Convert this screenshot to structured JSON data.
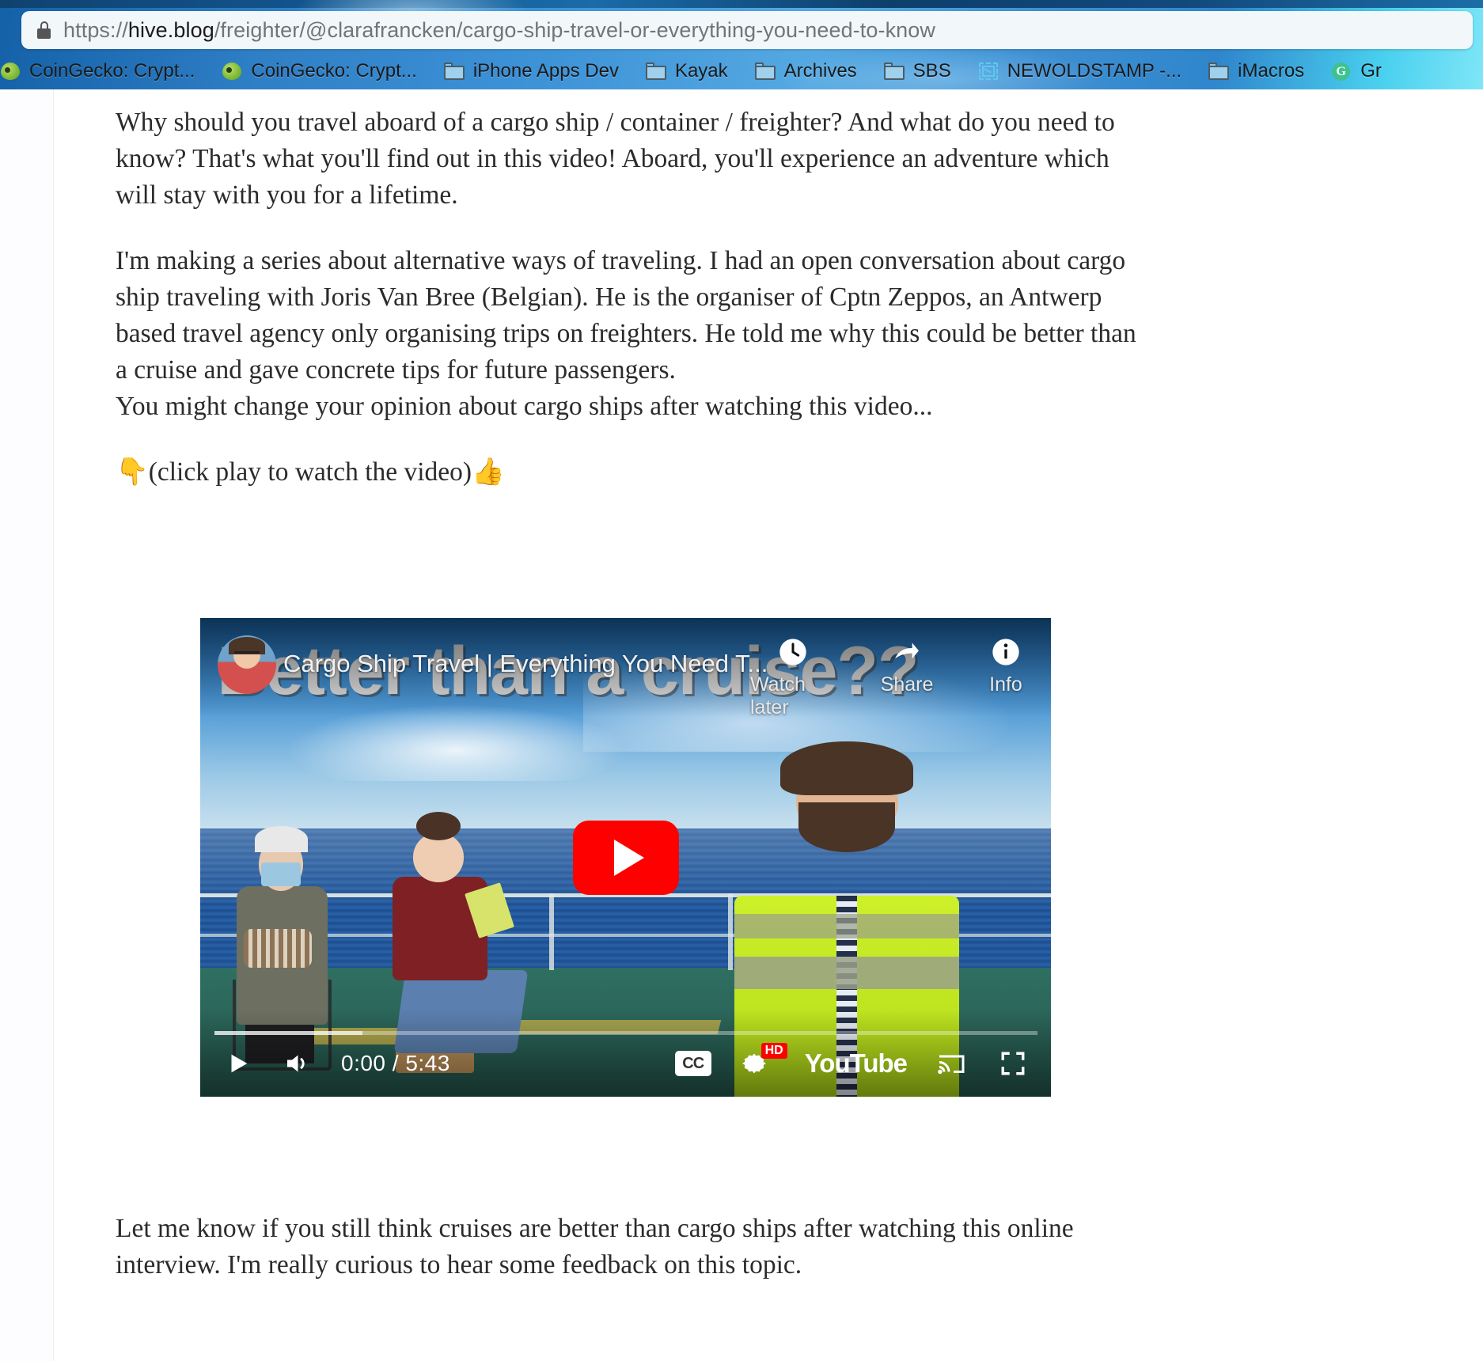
{
  "browser": {
    "address_bar": {
      "lock_icon": "lock-icon",
      "scheme": "https://",
      "host": "hive.blog",
      "path": "/freighter/@clarafrancken/cargo-ship-travel-or-everything-you-need-to-know",
      "full_url": "https://hive.blog/freighter/@clarafrancken/cargo-ship-travel-or-everything-you-need-to-know"
    },
    "bookmarks": [
      {
        "label": "CoinGecko: Crypt...",
        "icon": "gecko-icon"
      },
      {
        "label": "CoinGecko: Crypt...",
        "icon": "gecko-icon"
      },
      {
        "label": "iPhone Apps Dev",
        "icon": "folder-icon"
      },
      {
        "label": "Kayak",
        "icon": "folder-icon"
      },
      {
        "label": "Archives",
        "icon": "folder-icon"
      },
      {
        "label": "SBS",
        "icon": "folder-icon"
      },
      {
        "label": "NEWOLDSTAMP -...",
        "icon": "stamp-icon"
      },
      {
        "label": "iMacros",
        "icon": "folder-icon"
      },
      {
        "label": "Gr",
        "icon": "grammarly-icon"
      }
    ]
  },
  "article": {
    "paragraph_1": "Why should you travel aboard of a cargo ship / container / freighter? And what do you need to know? That's what you'll find out in this video! Aboard, you'll experience an adventure which will stay with you for a lifetime.",
    "paragraph_2_line_1": "I'm making a series about alternative ways of traveling. I had an open conversation about cargo ship traveling with Joris Van Bree (Belgian). He is the organiser of Cptn Zeppos, an Antwerp based travel agency only organising trips on freighters. He told me why this could be better than a cruise and gave concrete tips for future passengers.",
    "paragraph_2_line_2": "You might change your opinion about cargo ships after watching this video...",
    "paragraph_3": "👇(click play to watch the video)👍",
    "paragraph_4": "Let me know if you still think cruises are better than cargo ships after watching this online interview. I'm really curious to hear some feedback on this topic."
  },
  "video": {
    "title": "Cargo Ship Travel | Everything You Need T...",
    "thumbnail_overlay_text": "Better than a cruise??",
    "watch_later_label": "Watch later",
    "share_label": "Share",
    "info_label": "Info",
    "current_time": "0:00",
    "duration": "5:43",
    "time_display": "0:00 / 5:43",
    "cc_label": "CC",
    "quality_badge": "HD",
    "brand": "YouTube",
    "play_button": "play-button-icon"
  },
  "colors": {
    "youtube_red": "#ff0000",
    "chrome_blue": "#3f94d8",
    "text": "#2b2b2b",
    "url_muted": "#6f7578"
  }
}
